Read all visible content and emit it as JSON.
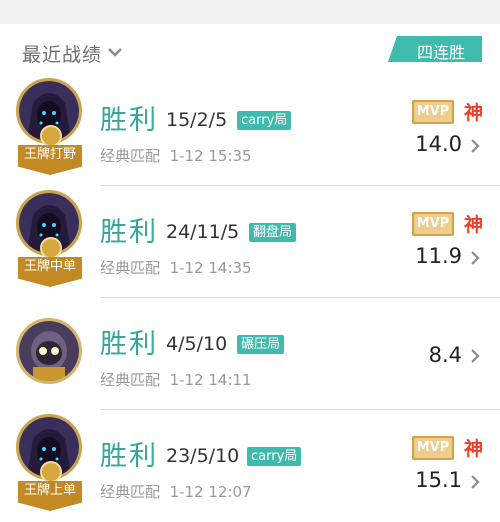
{
  "header": {
    "title": "最近战绩",
    "streak_badge": "四连胜"
  },
  "matches": [
    {
      "result": "胜利",
      "kda": "15/2/5",
      "tag": "carry局",
      "mode": "经典匹配",
      "time": "1-12 15:35",
      "rank_ribbon": "王牌打野",
      "mvp": "MVP",
      "god": "神",
      "score": "14.0",
      "hero_icon": "hooded-assassin-hero"
    },
    {
      "result": "胜利",
      "kda": "24/11/5",
      "tag": "翻盘局",
      "mode": "经典匹配",
      "time": "1-12 14:35",
      "rank_ribbon": "王牌中单",
      "mvp": "MVP",
      "god": "神",
      "score": "11.9",
      "hero_icon": "hooded-assassin-hero"
    },
    {
      "result": "胜利",
      "kda": "4/5/10",
      "tag": "碾压局",
      "mode": "经典匹配",
      "time": "1-12 14:11",
      "score": "8.4",
      "hero_icon": "mecha-hero"
    },
    {
      "result": "胜利",
      "kda": "23/5/10",
      "tag": "carry局",
      "mode": "经典匹配",
      "time": "1-12 12:07",
      "rank_ribbon": "王牌上单",
      "mvp": "MVP",
      "god": "神",
      "score": "15.1",
      "hero_icon": "hooded-assassin-hero"
    }
  ]
}
